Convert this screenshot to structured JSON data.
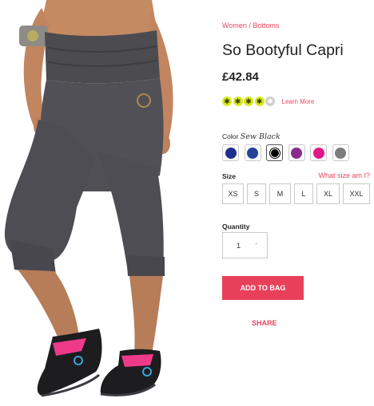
{
  "breadcrumb": "Women / Bottoms",
  "product": {
    "title": "So Bootyful Capri",
    "price": "£42.84"
  },
  "rating": {
    "stars": 4,
    "max": 5,
    "learn_more": "Learn More"
  },
  "color": {
    "label": "Color",
    "selected_name": "Sew Black",
    "swatches": [
      {
        "name": "navy",
        "hex": "#1d2f8c"
      },
      {
        "name": "royal-blue",
        "hex": "#23439a"
      },
      {
        "name": "black",
        "hex": "#000000",
        "selected": true
      },
      {
        "name": "purple",
        "hex": "#8a2b8e"
      },
      {
        "name": "pink",
        "hex": "#e0188a"
      },
      {
        "name": "gray",
        "hex": "#7c7c7c"
      }
    ]
  },
  "size": {
    "label": "Size",
    "help": "What size am I?",
    "options": [
      "XS",
      "S",
      "M",
      "L",
      "XL",
      "XXL"
    ]
  },
  "quantity": {
    "label": "Quantity",
    "value": "1",
    "stepper": "·"
  },
  "add_to_bag": "ADD TO BAG",
  "share": "SHARE",
  "colors": {
    "accent": "#e8405a",
    "star": "#d7e91a"
  }
}
